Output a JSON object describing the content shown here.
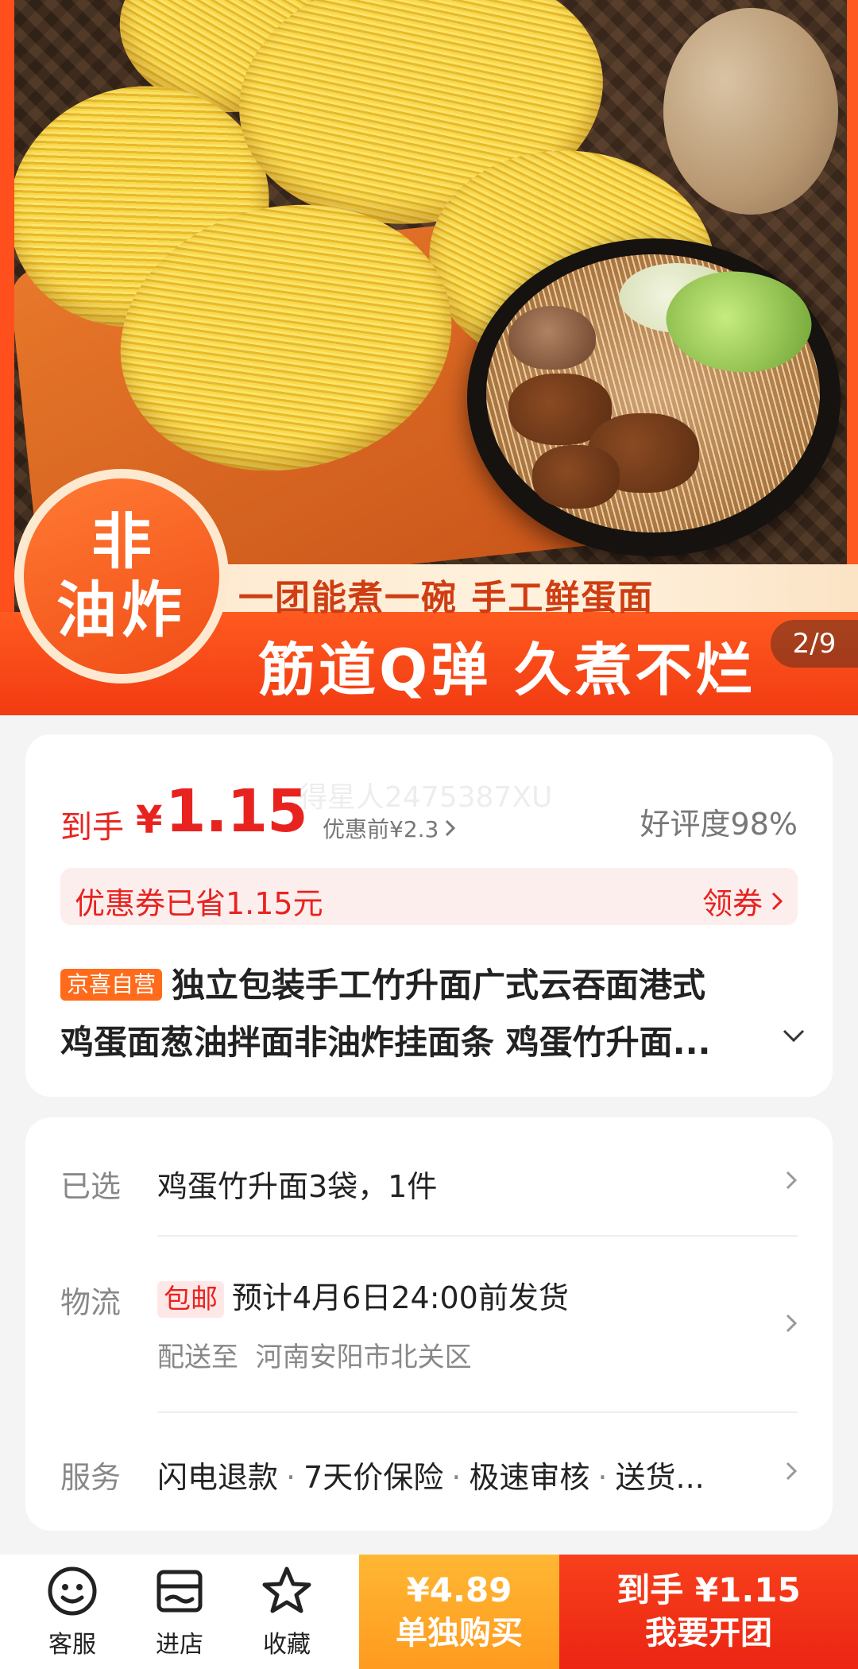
{
  "hero": {
    "badge_line1": "非",
    "badge_line2": "油炸",
    "banner_line1": "一团能煮一碗 手工鲜蛋面",
    "banner_line2": "筋道Q弹 久煮不烂",
    "image_counter": "2/9"
  },
  "price": {
    "label": "到手",
    "currency": "¥",
    "amount": "1.15",
    "original": "优惠前¥2.3",
    "watermark": "得星人2475387XU",
    "rating": "好评度98%"
  },
  "coupon": {
    "text": "优惠券已省1.15元",
    "cta": "领券"
  },
  "product": {
    "tag": "京喜自营",
    "title_line1": "独立包装手工竹升面广式云吞面港式",
    "title_line2": "鸡蛋面葱油拌面非油炸挂面条 鸡蛋竹升面..."
  },
  "details": {
    "selected": {
      "label": "已选",
      "value": "鸡蛋竹升面3袋，1件"
    },
    "logistics": {
      "label": "物流",
      "badge": "包邮",
      "value": "预计4月6日24:00前发货",
      "sub_prefix": "配送至",
      "address": "河南安阳市北关区"
    },
    "service": {
      "label": "服务",
      "items": [
        "闪电退款",
        "7天价保险",
        "极速审核",
        "送货..."
      ]
    }
  },
  "bottom_bar": {
    "service_label": "客服",
    "store_label": "进店",
    "favorite_label": "收藏",
    "single_price": "¥4.89",
    "single_label": "单独购买",
    "group_price": "到手 ¥1.15",
    "group_label": "我要开团"
  },
  "colors": {
    "accent_red": "#e8231f",
    "orange": "#ff9b1f",
    "tag_orange": "#ff6b1a"
  }
}
